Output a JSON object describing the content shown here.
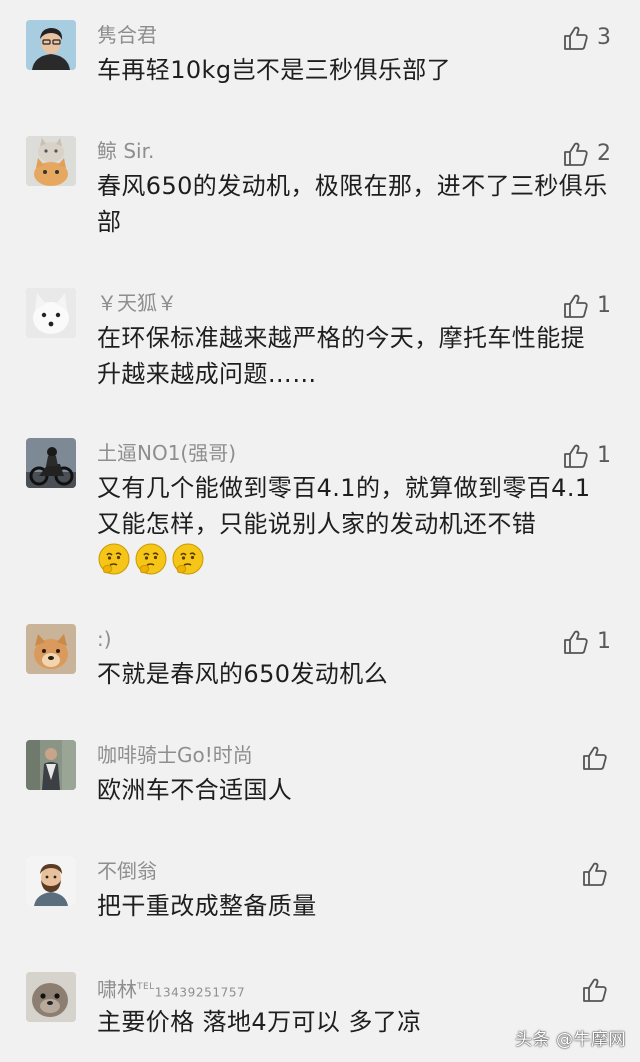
{
  "comments": [
    {
      "name": "隽合君",
      "text": "车再轻10kg岂不是三秒俱乐部了",
      "likes": "3",
      "avatar": "man-portrait-avatar"
    },
    {
      "name": "鲸 Sir.",
      "text": "春风650的发动机，极限在那，进不了三秒俱乐部",
      "likes": "2",
      "avatar": "cats-avatar"
    },
    {
      "name": "￥天狐￥",
      "text": "在环保标准越来越严格的今天，摩托车性能提升越来越成问题……",
      "likes": "1",
      "avatar": "white-fox-avatar"
    },
    {
      "name": "土逼NO1(强哥)",
      "text": "又有几个能做到零百4.1的，就算做到零百4.1又能怎样，只能说别人家的发动机还不错",
      "likes": "1",
      "avatar": "motorcycle-rider-avatar",
      "emoji_count": 3,
      "emoji_name": "thinking-face-emoji"
    },
    {
      "name": ":)",
      "text": "不就是春风的650发动机么",
      "likes": "1",
      "avatar": "dog-avatar"
    },
    {
      "name": "咖啡骑士Go!时尚",
      "text": "欧洲车不合适国人",
      "likes": "",
      "avatar": "rider-photo-avatar"
    },
    {
      "name": "不倒翁",
      "text": "把干重改成整备质量",
      "likes": "",
      "avatar": "bearded-man-avatar"
    },
    {
      "name": "啸林",
      "name_sup": "TEL",
      "name_sub": "13439251757",
      "text": "主要价格 落地4万可以 多了凉",
      "likes": "",
      "avatar": "seal-avatar"
    }
  ],
  "watermark": "头条 @牛摩网",
  "colors": {
    "background": "#f1f1f1",
    "name": "#8e8e8e",
    "text": "#1e1e1e",
    "like_icon": "#555555",
    "emoji": "#f5c518"
  }
}
